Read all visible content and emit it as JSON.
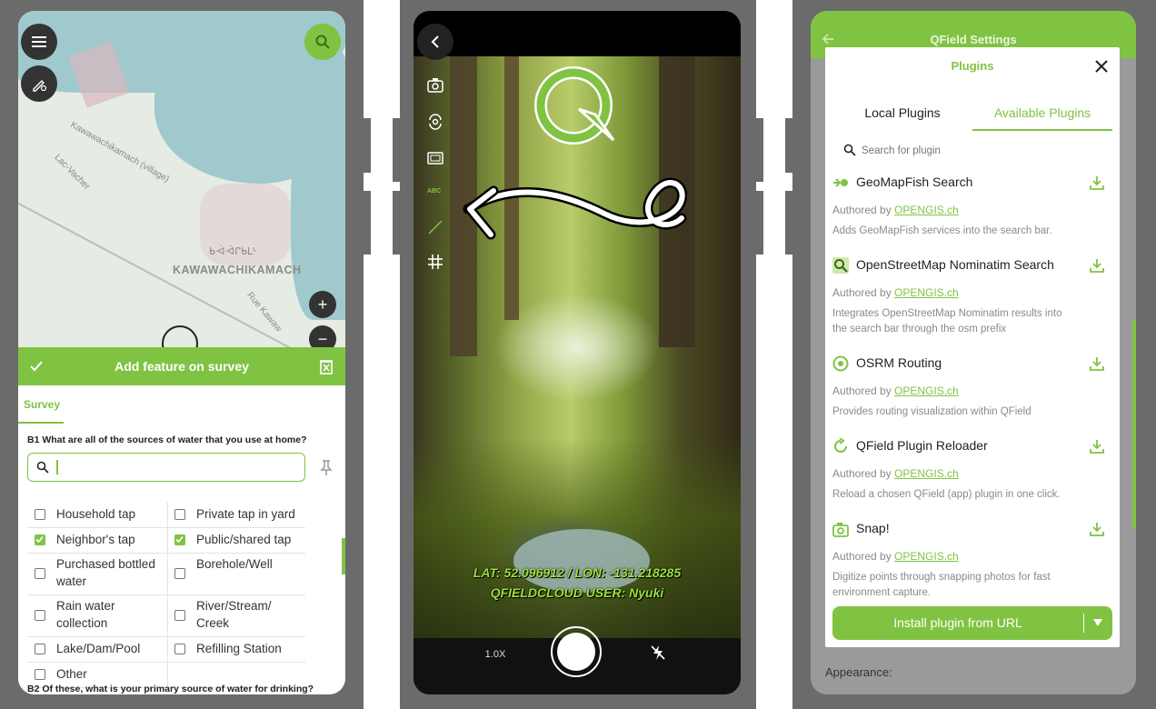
{
  "colors": {
    "accent": "#80c342",
    "bezel": "#6b6b6b"
  },
  "phone1": {
    "map": {
      "town_label": "KAWAWACHIKAMACH",
      "syllabics": "ᑲᐙᐙᒋᑲᒪᒡ",
      "village_label": "Kawawachikamach (village)",
      "lake_label": "Lac-Vacher",
      "road_label": "Rue Kawaw"
    },
    "form": {
      "title": "Add feature on survey",
      "tab": "Survey",
      "question1": "B1 What are all of the sources of water that you use at home?",
      "question2": "B2 Of these, what is your primary source of water for drinking?",
      "options": [
        {
          "label": "Household tap",
          "checked": false
        },
        {
          "label": "Private tap in yard",
          "checked": false
        },
        {
          "label": "Neighbor's tap",
          "checked": true
        },
        {
          "label": "Public/shared tap",
          "checked": true
        },
        {
          "label": "Purchased bottled water",
          "checked": false
        },
        {
          "label": "Borehole/Well",
          "checked": false
        },
        {
          "label": "Rain water collection",
          "checked": false
        },
        {
          "label": "River/Stream/ Creek",
          "checked": false
        },
        {
          "label": "Lake/Dam/Pool",
          "checked": false
        },
        {
          "label": "Refilling Station",
          "checked": false
        },
        {
          "label": "Other",
          "checked": false
        }
      ]
    }
  },
  "phone2": {
    "overlay_line1": "LAT: 52.096912 / LON: -131.218285",
    "overlay_line2": "QFIELDCLOUD USER: Nyuki",
    "abc_label": "ABC",
    "zoom": "1.0X"
  },
  "phone3": {
    "header_title": "QField Settings",
    "dialog_title": "Plugins",
    "tabs": [
      "Local Plugins",
      "Available Plugins"
    ],
    "search_placeholder": "Search for plugin",
    "authored_prefix": "Authored by ",
    "plugins": [
      {
        "name": "GeoMapFish Search",
        "author": "OPENGIS.ch",
        "description": "Adds GeoMapFish services into the search bar.",
        "icon": "geomapfish-icon"
      },
      {
        "name": "OpenStreetMap Nominatim Search",
        "author": "OPENGIS.ch",
        "description": "Integrates OpenStreetMap Nominatim results into the search bar through the osm prefix",
        "icon": "nominatim-icon"
      },
      {
        "name": "OSRM Routing",
        "author": "OPENGIS.ch",
        "description": "Provides routing visualization within QField",
        "icon": "routing-icon"
      },
      {
        "name": "QField Plugin Reloader",
        "author": "OPENGIS.ch",
        "description": "Reload a chosen QField (app) plugin in one click.",
        "icon": "reload-icon"
      },
      {
        "name": "Snap!",
        "author": "OPENGIS.ch",
        "description": "Digitize points through snapping photos for fast environment capture.",
        "icon": "camera-icon"
      }
    ],
    "install_button": "Install plugin from URL",
    "appearance_label": "Appearance:"
  }
}
